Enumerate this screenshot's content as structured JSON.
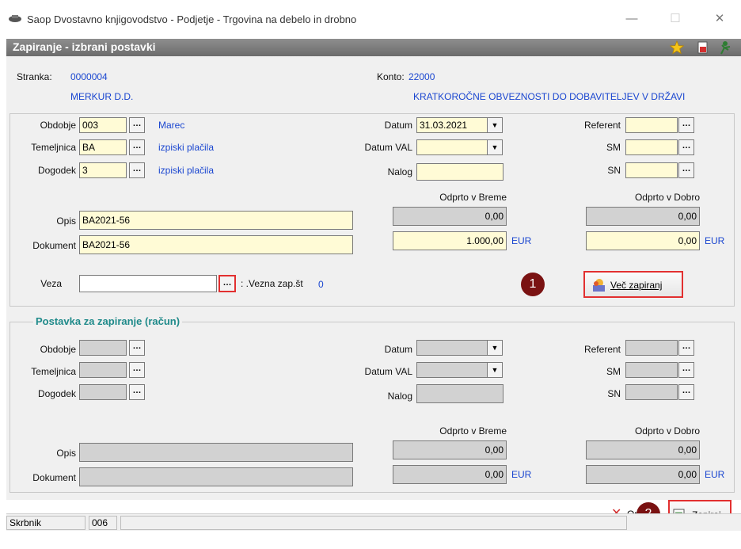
{
  "window": {
    "title": "Saop Dvostavno knjigovodstvo - Podjetje - Trgovina na debelo in drobno",
    "minimize": "—",
    "maximize": "☐",
    "close": "✕"
  },
  "dialog": {
    "caption": "Zapiranje - izbrani postavki"
  },
  "header": {
    "stranka_label": "Stranka:",
    "stranka_value": "0000004",
    "stranka_name": "MERKUR D.D.",
    "konto_label": "Konto:",
    "konto_value": "22000",
    "konto_name": "KRATKOROČNE OBVEZNOSTI DO DOBAVITELJEV V DRŽAVI"
  },
  "section1": {
    "obdobje_label": "Obdobje",
    "obdobje_value": "003",
    "obdobje_desc": "Marec",
    "temeljnica_label": "Temeljnica",
    "temeljnica_value": "BA",
    "temeljnica_desc": "izpiski plačila",
    "dogodek_label": "Dogodek",
    "dogodek_value": "3",
    "dogodek_desc": "izpiski plačila",
    "datum_label": "Datum",
    "datum_value": "31.03.2021",
    "datum_val_label": "Datum VAL",
    "datum_val_value": "",
    "nalog_label": "Nalog",
    "nalog_value": "",
    "referent_label": "Referent",
    "referent_value": "",
    "sm_label": "SM",
    "sm_value": "",
    "sn_label": "SN",
    "sn_value": "",
    "odprto_breme_label": "Odprto v Breme",
    "odprto_breme_value": "0,00",
    "odprto_dobro_label": "Odprto v Dobro",
    "odprto_dobro_value": "0,00",
    "znesek_breme": "1.000,00",
    "znesek_dobro": "0,00",
    "currency": "EUR",
    "opis_label": "Opis",
    "opis_value": "BA2021-56",
    "dokument_label": "Dokument",
    "dokument_value": "BA2021-56",
    "veza_label": "Veza",
    "veza_value": "",
    "vezna_label": ": .Vezna zap.št",
    "vezna_value": "0",
    "vec_zapiranj_label": "Več zapiranj"
  },
  "section2": {
    "title": "Postavka za zapiranje  (račun)",
    "obdobje_label": "Obdobje",
    "temeljnica_label": "Temeljnica",
    "dogodek_label": "Dogodek",
    "datum_label": "Datum",
    "datum_val_label": "Datum VAL",
    "nalog_label": "Nalog",
    "referent_label": "Referent",
    "sm_label": "SM",
    "sn_label": "SN",
    "odprto_breme_label": "Odprto v Breme",
    "odprto_breme_value": "0,00",
    "odprto_dobro_label": "Odprto v Dobro",
    "odprto_dobro_value": "0,00",
    "znesek_breme": "0,00",
    "znesek_dobro": "0,00",
    "currency": "EUR",
    "opis_label": "Opis",
    "dokument_label": "Dokument"
  },
  "footer": {
    "opusti_label": "Opusti",
    "zapiraj_label": "Zapiraj"
  },
  "badges": {
    "one": "1",
    "two": "2"
  },
  "statusbar": {
    "user": "Skrbnik",
    "code": "006"
  },
  "colors": {
    "highlight": "#e23030",
    "badge": "#7a1212",
    "link_blue": "#1a46d0",
    "group_title": "#1f8a8a",
    "input_yellow": "#fffbd6"
  }
}
